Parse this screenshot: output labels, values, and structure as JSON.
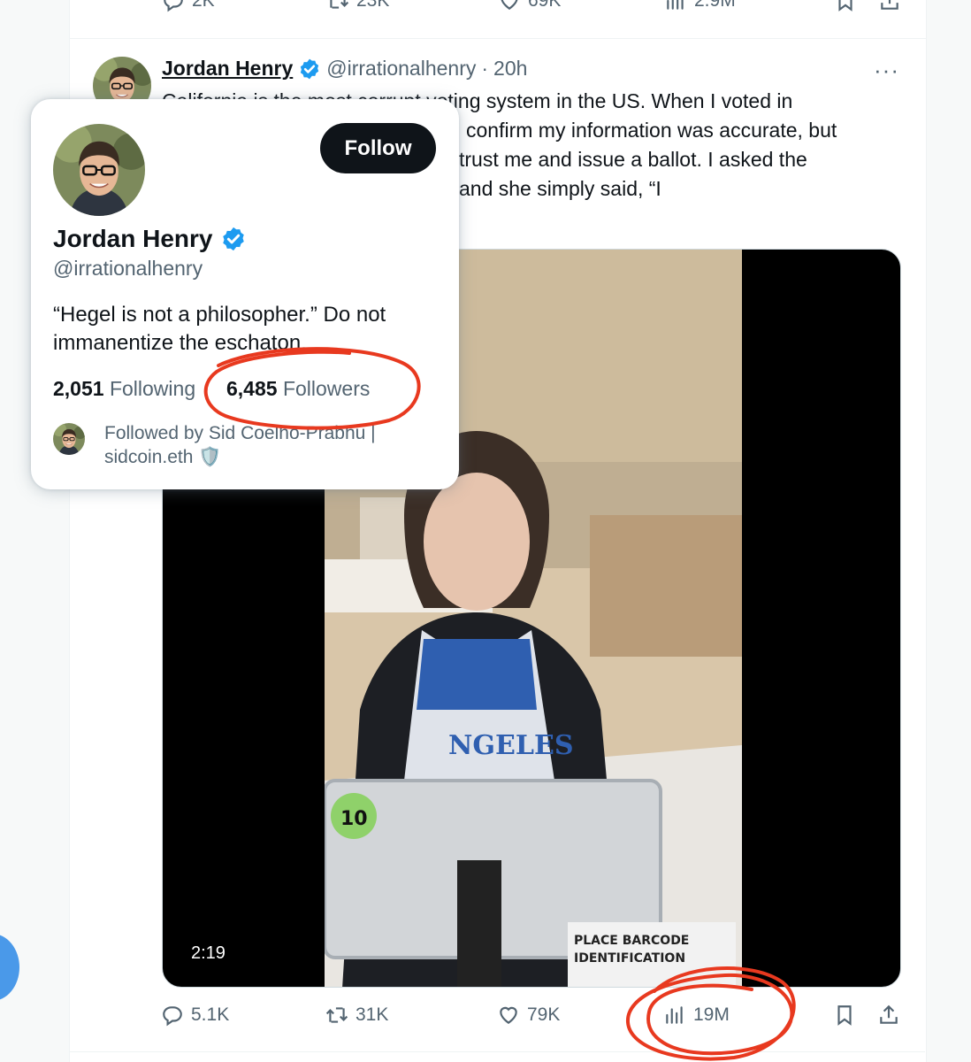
{
  "top_actions": {
    "replies": "2K",
    "retweets": "23K",
    "likes": "69K",
    "views": "2.9M"
  },
  "tweet": {
    "author_name": "Jordan Henry",
    "handle": "@irrationalhenry",
    "separator": "·",
    "time": "20h",
    "more": "···",
    "text_lines": [
      "California is the most corrupt voting system in the US. When I voted in",
      "confirm my information was accurate, but",
      "trust me and issue a ballot. I asked the",
      "and she simply said, “I"
    ],
    "media": {
      "duration": "2:19"
    },
    "actions": {
      "replies": "5.1K",
      "retweets": "31K",
      "likes": "79K",
      "views": "19M"
    }
  },
  "hovercard": {
    "follow_label": "Follow",
    "name": "Jordan Henry",
    "handle": "@irrationalhenry",
    "bio": "“Hegel is not a philosopher.” Do not immanentize the eschaton.",
    "following_count": "2,051",
    "following_label": "Following",
    "followers_count": "6,485",
    "followers_label": "Followers",
    "followed_by": "Followed by Sid Coelho-Prabhu | sidcoin.eth 🛡️"
  },
  "colors": {
    "annotation": "#e8391f",
    "verified": "#1d9bf0",
    "muted": "#536471",
    "fab": "#4a99e9"
  },
  "icons": [
    "reply-icon",
    "retweet-icon",
    "like-icon",
    "views-icon",
    "bookmark-icon",
    "share-icon",
    "verified-badge-icon"
  ]
}
